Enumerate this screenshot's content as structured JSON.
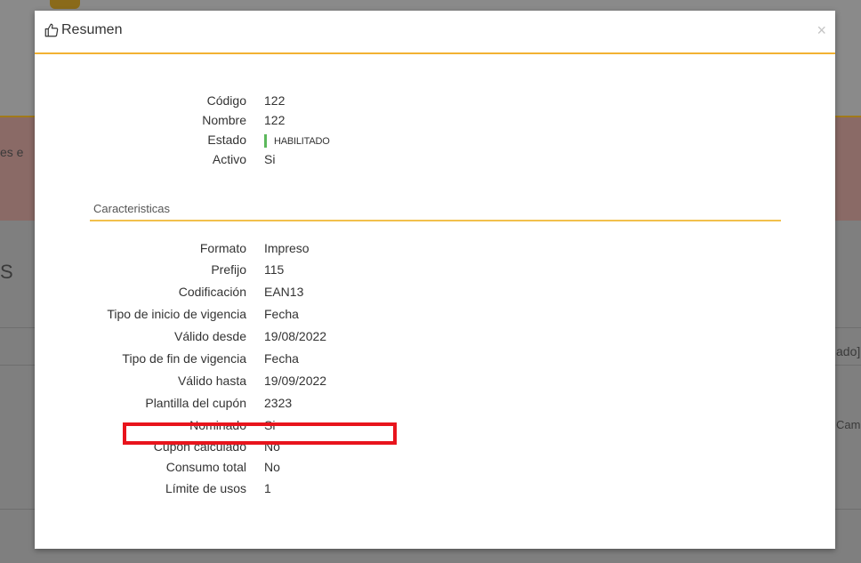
{
  "background": {
    "fragment_left_1": "es e",
    "fragment_left_2": "S",
    "fragment_right_1": "ado]",
    "fragment_right_2": "Cam"
  },
  "modal": {
    "title": "Resumen",
    "title_icon": "thumbs-up-icon",
    "close_label": "×",
    "summary": [
      {
        "label": "Código",
        "value": "122"
      },
      {
        "label": "Nombre",
        "value": "122"
      },
      {
        "label": "Estado",
        "value": "HABILITADO",
        "status_color": "#5cb85c"
      },
      {
        "label": "Activo",
        "value": "Si"
      }
    ],
    "section_title": "Caracteristicas",
    "characteristics": [
      {
        "label": "Formato",
        "value": "Impreso"
      },
      {
        "label": "Prefijo",
        "value": "115"
      },
      {
        "label": "Codificación",
        "value": "EAN13"
      },
      {
        "label": "Tipo de inicio de vigencia",
        "value": "Fecha"
      },
      {
        "label": "Válido desde",
        "value": "19/08/2022"
      },
      {
        "label": "Tipo de fin de vigencia",
        "value": "Fecha"
      },
      {
        "label": "Válido hasta",
        "value": "19/09/2022"
      },
      {
        "label": "Plantilla del cupón",
        "value": "2323"
      },
      {
        "label": "Nominado",
        "value": "Si"
      },
      {
        "label": "Cupon calculado",
        "value": "No"
      },
      {
        "label": "Consumo total",
        "value": "No"
      },
      {
        "label": "Límite de usos",
        "value": "1"
      }
    ],
    "highlight_color": "#e8141c"
  }
}
